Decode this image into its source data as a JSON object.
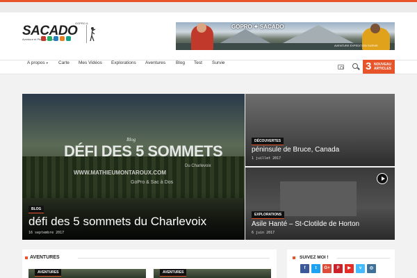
{
  "colors": {
    "accent": "#e8542a",
    "facebook": "#3b5998",
    "twitter": "#1da1f2",
    "googleplus": "#dd4b39",
    "pinterest": "#cb2027",
    "youtube": "#e52d27",
    "vimeo": "#44bbff",
    "instagram": "#3f729b"
  },
  "logo": {
    "word": "SACADO",
    "super": "GOPRO &",
    "tagline": "Aventure et Photographie"
  },
  "banner": {
    "text": "GOPRO ✦ SACADO",
    "sub": "AVENTURE  EXPEDITION  SURVIE"
  },
  "nav": {
    "items": [
      "A propos",
      "Carte",
      "Mes Vidéos",
      "Explorations",
      "Aventures",
      "Blog",
      "Test",
      "Survie"
    ],
    "caret": "▾",
    "icons": [
      "camera-icon",
      "search-icon"
    ]
  },
  "new_badge": {
    "count": "3",
    "label": "NOUVEAU ARTICLES"
  },
  "featured": {
    "main": {
      "category": "BLOG",
      "title": "défi des 5 sommets du Charlevoix",
      "date": "16 septembre 2017",
      "watermark": {
        "blog": "Blog",
        "headline": "DÉFI DES 5 SOMMETS",
        "region": "Du Charlevoix",
        "url": "WWW.MATHIEUMONTAROUX.COM",
        "brand": "GoPro & Sac à Dos"
      }
    },
    "side": [
      {
        "category": "DÉCOUVERTES",
        "title": "péninsule de Bruce, Canada",
        "date": "1 juillet 2017"
      },
      {
        "category": "EXPLORATIONS",
        "title": "Asile Hanté – St-Clotilde de Horton",
        "date": "6 juin 2017"
      }
    ]
  },
  "aventures": {
    "title": "AVENTURES",
    "cards": [
      {
        "category": "AVENTURES"
      },
      {
        "category": "AVENTURES"
      }
    ]
  },
  "social": {
    "title": "SUIVEZ MOI !",
    "networks": [
      {
        "name": "facebook-icon",
        "glyph": "f"
      },
      {
        "name": "twitter-icon",
        "glyph": "t"
      },
      {
        "name": "googleplus-icon",
        "glyph": "G+"
      },
      {
        "name": "pinterest-icon",
        "glyph": "P"
      },
      {
        "name": "youtube-icon",
        "glyph": "▶"
      },
      {
        "name": "vimeo-icon",
        "glyph": "v"
      },
      {
        "name": "instagram-icon",
        "glyph": "◎"
      }
    ]
  }
}
